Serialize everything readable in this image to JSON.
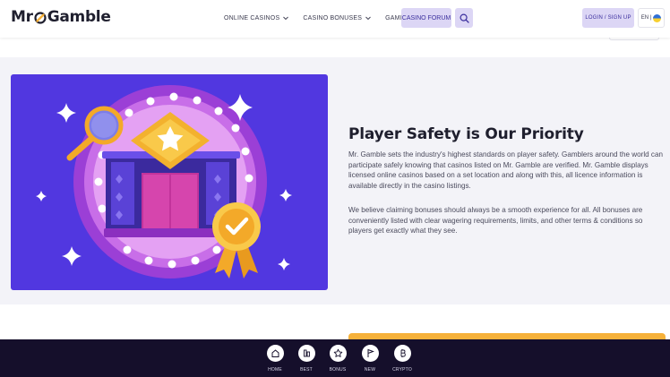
{
  "header": {
    "logo_text_left": "Mr",
    "logo_text_right": "Gamble",
    "nav": [
      {
        "label": "ONLINE CASINOS"
      },
      {
        "label": "CASINO BONUSES"
      },
      {
        "label": "GAMING"
      }
    ],
    "forum_label": "CASINO FORUM",
    "login_label": "LOGIN / SIGN UP",
    "language_label": "EN |",
    "search_icon": "search-icon"
  },
  "main": {
    "title": "Player Safety is Our Priority",
    "paragraph1": "Mr. Gamble sets the industry's highest standards on player safety. Gamblers around the world can participate safely knowing that casinos listed on Mr. Gamble are verified. Mr. Gamble displays licensed online casinos based on a set location and along with this, all licence information is available directly in the casino listings.",
    "paragraph2": "We believe claiming bonuses should always be a smooth experience for all. All bonuses are conveniently listed with clear wagering requirements, limits, and other terms & conditions so players get exactly what they see."
  },
  "bottom_nav": [
    {
      "label": "HOME",
      "icon": "home-icon"
    },
    {
      "label": "BEST",
      "icon": "best-icon"
    },
    {
      "label": "BONUS",
      "icon": "star-icon"
    },
    {
      "label": "NEW",
      "icon": "flag-icon"
    },
    {
      "label": "CRYPTO",
      "icon": "bitcoin-icon"
    }
  ],
  "colors": {
    "brand_purple": "#5137e0",
    "accent_lavender": "#dcd6f5",
    "dark_nav": "#150f2b",
    "gold": "#f6b13a"
  }
}
